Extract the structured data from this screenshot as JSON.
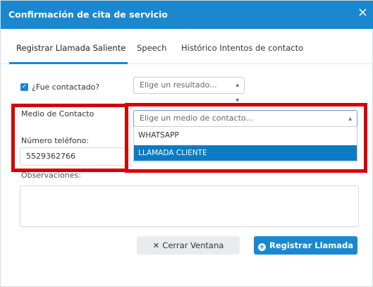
{
  "header": {
    "title": "Confirmación de cita de servicio",
    "close_symbol": "×"
  },
  "tabs": [
    {
      "label": "Registrar Llamada Saliente"
    },
    {
      "label": "Speech"
    },
    {
      "label": "Histórico Intentos de contacto"
    }
  ],
  "form": {
    "contacted_label": "¿Fue contactado?",
    "contacted_checked": true,
    "result_placeholder": "Elige un resultado...",
    "contact_method_label": "Medio de Contacto",
    "contact_method_placeholder": "Elige un medio de contacto...",
    "contact_method_options": [
      "WHATSAPP",
      "LLAMADA CLIENTE"
    ],
    "highlighted_option": "LLAMADA CLIENTE",
    "phone_label": "Número teléfono:",
    "phone_value": "5529362766",
    "observations_label": "Observaciones:"
  },
  "buttons": {
    "close_label": "Cerrar Ventana",
    "register_label": "Registrar Llamada"
  },
  "colors": {
    "primary": "#1b87cf",
    "highlight_red": "#d50000",
    "selected_option": "#0b7bc4"
  }
}
